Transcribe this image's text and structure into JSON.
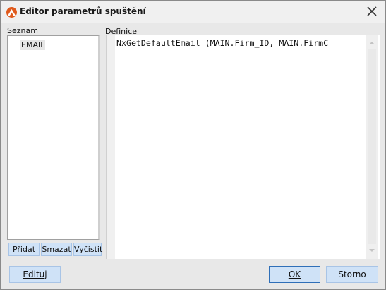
{
  "window": {
    "title": "Editor parametrů spuštění"
  },
  "left_panel": {
    "label": "Seznam",
    "items": [
      "EMAIL"
    ],
    "buttons": {
      "add": "Přidat",
      "delete": "Smazat",
      "clear": "Vyčistit"
    }
  },
  "right_panel": {
    "label": "Definice",
    "code": "NxGetDefaultEmail (MAIN.Firm_ID, MAIN.FirmC"
  },
  "footer": {
    "edit": "Edituj",
    "ok": "OK",
    "cancel": "Storno"
  },
  "colors": {
    "accent": "#e05a1c",
    "button_bg": "#cfe2f7",
    "button_border": "#a8c4e6"
  }
}
